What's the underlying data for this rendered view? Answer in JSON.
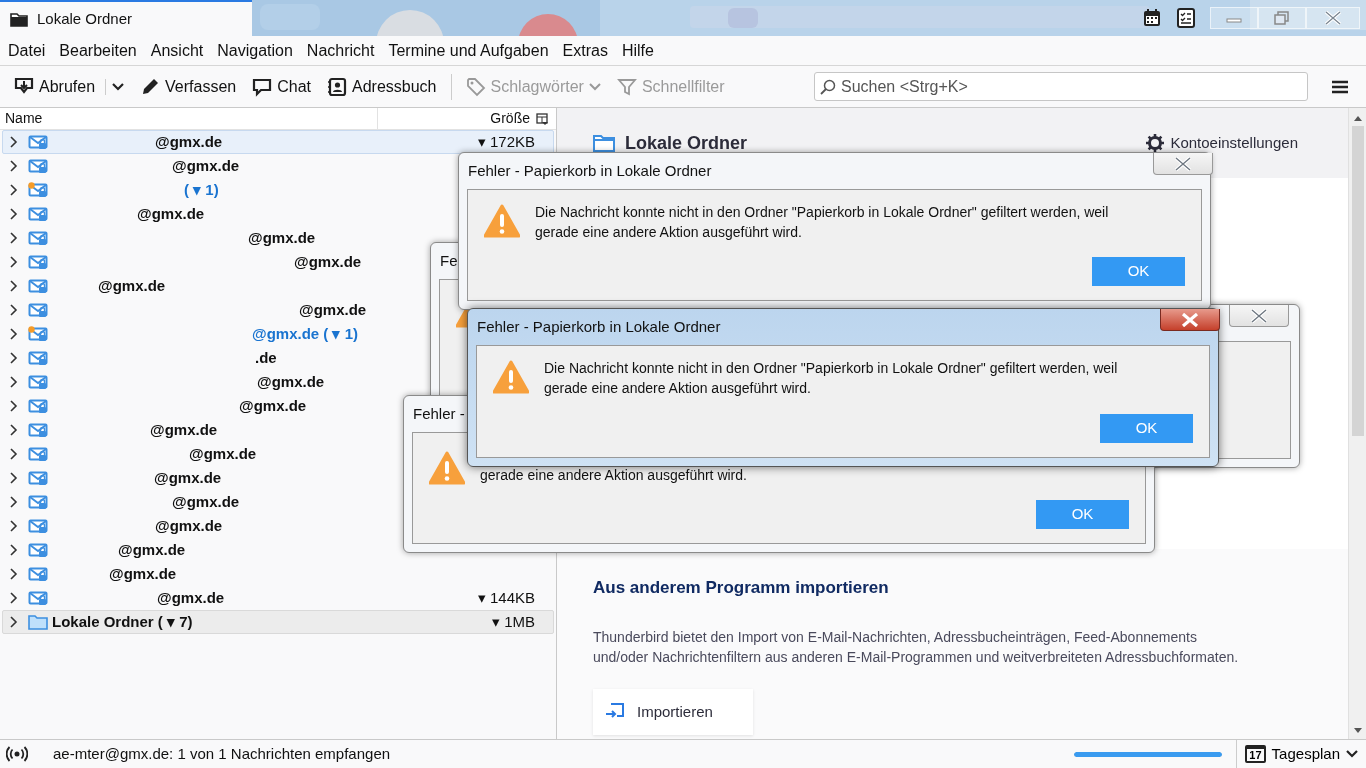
{
  "window": {
    "tab_title": "Lokale Ordner"
  },
  "menu": [
    "Datei",
    "Bearbeiten",
    "Ansicht",
    "Navigation",
    "Nachricht",
    "Termine und Aufgaben",
    "Extras",
    "Hilfe"
  ],
  "toolbar": [
    {
      "kind": "get",
      "label": "Abrufen",
      "disabled": false
    },
    {
      "kind": "dropdown",
      "disabled": false
    },
    {
      "kind": "write",
      "label": "Verfassen",
      "disabled": false
    },
    {
      "kind": "chat",
      "label": "Chat",
      "disabled": false
    },
    {
      "kind": "addressbook",
      "label": "Adressbuch",
      "disabled": false
    },
    {
      "kind": "tags",
      "label": "Schlagwörter",
      "disabled": true
    },
    {
      "kind": "filter",
      "label": "Schnellfilter",
      "disabled": true
    }
  ],
  "search": {
    "placeholder": "Suchen <Strg+K>"
  },
  "folder_pane": {
    "columns": [
      "Name",
      "Größe"
    ],
    "rows": [
      {
        "kind": "account",
        "name": "@gmx.de",
        "unread": false,
        "selected": true,
        "expanded": false,
        "size": "▾ 172KB"
      },
      {
        "kind": "account",
        "name": "@gmx.de",
        "unread": false,
        "selected": false,
        "expanded": false
      },
      {
        "kind": "account",
        "name": "( ▾ 1)",
        "unread": true,
        "selected": false,
        "expanded": false
      },
      {
        "kind": "account",
        "name": "@gmx.de",
        "unread": false,
        "selected": false,
        "expanded": false
      },
      {
        "kind": "account",
        "name": "@gmx.de",
        "unread": false,
        "selected": false,
        "expanded": false
      },
      {
        "kind": "account",
        "name": "@gmx.de",
        "unread": false,
        "selected": false,
        "expanded": false
      },
      {
        "kind": "account",
        "name": "@gmx.de",
        "unread": false,
        "selected": false,
        "expanded": false
      },
      {
        "kind": "account",
        "name": "@gmx.de",
        "unread": false,
        "selected": false,
        "expanded": false
      },
      {
        "kind": "account",
        "name": "@gmx.de ( ▾ 1)",
        "unread": true,
        "selected": false,
        "expanded": false
      },
      {
        "kind": "account",
        "name": ".de",
        "unread": false,
        "selected": false,
        "expanded": false
      },
      {
        "kind": "account",
        "name": "@gmx.de",
        "unread": false,
        "selected": false,
        "expanded": false
      },
      {
        "kind": "account",
        "name": "@gmx.de",
        "unread": false,
        "selected": false,
        "expanded": false
      },
      {
        "kind": "account",
        "name": "@gmx.de",
        "unread": false,
        "selected": false,
        "expanded": false
      },
      {
        "kind": "account",
        "name": "@gmx.de",
        "unread": false,
        "selected": false,
        "expanded": false
      },
      {
        "kind": "account",
        "name": "@gmx.de",
        "unread": false,
        "selected": false,
        "expanded": false
      },
      {
        "kind": "account",
        "name": "@gmx.de",
        "unread": false,
        "selected": false,
        "expanded": false
      },
      {
        "kind": "account",
        "name": "@gmx.de",
        "unread": false,
        "selected": false,
        "expanded": false
      },
      {
        "kind": "account",
        "name": "@gmx.de",
        "unread": false,
        "selected": false,
        "expanded": false
      },
      {
        "kind": "account",
        "name": "@gmx.de",
        "unread": false,
        "selected": false,
        "expanded": false
      },
      {
        "kind": "account",
        "name": "@gmx.de",
        "unread": false,
        "selected": false,
        "expanded": false,
        "size": "▾ 144KB"
      },
      {
        "kind": "local",
        "name": "Lokale Ordner ( ▾ 7)",
        "unread": false,
        "selected": false,
        "expanded": false,
        "size": "▾ 1MB"
      }
    ]
  },
  "account_view": {
    "title": "Lokale Ordner",
    "settings_link": "Kontoeinstellungen",
    "import_title": "Aus anderem Programm importieren",
    "import_text": "Thunderbird bietet den Import von E-Mail-Nachrichten, Adressbucheinträgen, Feed-Abonnements und/oder Nachrichtenfiltern aus anderen E-Mail-Programmen und weitverbreiteten Adressbuchformaten.",
    "import_button": "Importieren"
  },
  "dialogs": [
    {
      "title": "Fe",
      "focused": false
    },
    {
      "focused": false
    },
    {
      "title": "Fehler - Papierkorb in Lokale Ordner",
      "message": "Die Nachricht konnte nicht in den Ordner \"Papierkorb in Lokale Ordner\" gefiltert werden, weil gerade eine andere Aktion ausgeführt wird.",
      "button": "OK",
      "focused": false
    },
    {
      "title": "Fehler -",
      "message": "gerade eine andere Aktion ausgeführt wird.",
      "button": "OK",
      "focused": false
    },
    {
      "title": "Fehler - Papierkorb in Lokale Ordner",
      "message": "Die Nachricht konnte nicht in den Ordner \"Papierkorb in Lokale Ordner\" gefiltert werden, weil gerade eine andere Aktion ausgeführt wird.",
      "button": "OK",
      "focused": true
    }
  ],
  "status_bar": {
    "text": "ae-mter@gmx.de: 1 von 1 Nachrichten empfangen",
    "progress": {
      "level": 1
    },
    "calendar_day": "17",
    "today_pane": "Tagesplan"
  }
}
